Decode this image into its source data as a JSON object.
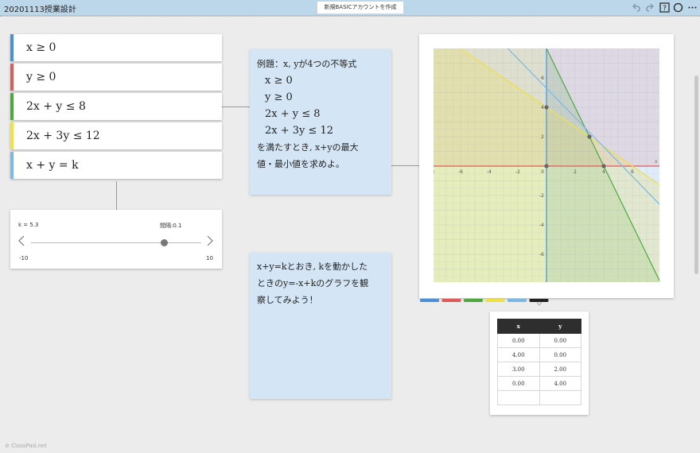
{
  "header": {
    "title": "20201113授業設計",
    "create_account": "新規BASICアカウントを作成"
  },
  "conditions": [
    {
      "label": "x ≥ 0",
      "color": "#4a90d9"
    },
    {
      "label": "y ≥ 0",
      "color": "#e05a5a"
    },
    {
      "label": "2x + y ≤ 8",
      "color": "#4caa3c"
    },
    {
      "label": "2x + 3y ≤ 12",
      "color": "#f0e040"
    },
    {
      "label": "x + y = k",
      "color": "#7ab8e6"
    }
  ],
  "slider": {
    "value_label": "k = 5.3",
    "step_label": "間隔:0.1",
    "min": "-10",
    "max": "10",
    "value": 5.3,
    "range": [
      -10,
      10
    ]
  },
  "note1": {
    "lines": [
      "例題：x, yが4つの不等式",
      "x ≥ 0",
      "y ≥ 0",
      "2x + y ≤ 8",
      "2x + 3y ≤ 12",
      "を満たすとき, x+yの最大",
      "値・最小値を求めよ。"
    ]
  },
  "note2": {
    "lines": [
      "x+y=kとおき, kを動かした",
      "ときのy=-x+kのグラフを観",
      "察してみよう！"
    ]
  },
  "graph": {
    "x_ticks": [
      "-8",
      "-6",
      "-4",
      "-2",
      "0",
      "2",
      "4",
      "6"
    ],
    "y_ticks": [
      "6",
      "4",
      "2",
      "-2",
      "-4",
      "-6"
    ],
    "x_axis_label": "x",
    "xlim": [
      -8,
      8
    ],
    "ylim": [
      -8,
      8
    ],
    "points": [
      [
        0,
        0
      ],
      [
        4,
        0
      ],
      [
        3,
        2
      ],
      [
        0,
        4
      ]
    ]
  },
  "table": {
    "headers": [
      "x",
      "y"
    ],
    "rows": [
      [
        "0.00",
        "0.00"
      ],
      [
        "4.00",
        "0.00"
      ],
      [
        "3.00",
        "2.00"
      ],
      [
        "0.00",
        "4.00"
      ],
      [
        "",
        ""
      ]
    ]
  },
  "tab_colors": [
    "#4a90d9",
    "#e05a5a",
    "#4caa3c",
    "#f0e040",
    "#7ab8e6",
    "#222222"
  ],
  "footer": "ClassPad.net"
}
